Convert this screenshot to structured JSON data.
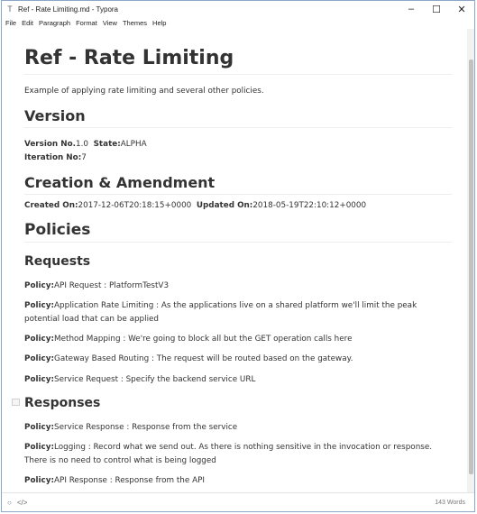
{
  "window": {
    "title": "Ref - Rate Limiting.md - Typora"
  },
  "controls": {
    "minimize": "–",
    "maximize": "☐",
    "close": "✕"
  },
  "menu": [
    "File",
    "Edit",
    "Paragraph",
    "Format",
    "View",
    "Themes",
    "Help"
  ],
  "doc": {
    "title": "Ref - Rate Limiting",
    "intro": "Example of applying rate limiting and several other policies.",
    "version_heading": "Version",
    "version_no_label": "Version No.",
    "version_no": "1.0",
    "state_label": "State:",
    "state": "ALPHA",
    "iteration_label": "Iteration No:",
    "iteration": "7",
    "creation_heading": "Creation & Amendment",
    "created_label": "Created On:",
    "created": "2017-12-06T20:18:15+0000",
    "updated_label": "Updated On:",
    "updated": "2018-05-19T22:10:12+0000",
    "policies_heading": "Policies",
    "requests_heading": "Requests",
    "policy_label": "Policy:",
    "requests": [
      "API Request : PlatformTestV3",
      "Application Rate Limiting : As the applications live on a shared platform we'll limit the peak potential load that can be applied",
      "Method Mapping : We're going to block all but the GET operation calls here",
      "Gateway Based Routing : The request will be routed based on the gateway.",
      "Service Request : Specify the backend service URL"
    ],
    "responses_heading": "Responses",
    "responses": [
      "Service Response : Response from the service",
      "Logging : Record what we send out. As there is nothing sensitive in the invocation or response. There is no need to control what is being logged",
      "API Response : Response from the API"
    ]
  },
  "status": {
    "words": "143 Words",
    "left_icon": "○",
    "code_icon": "</>"
  }
}
